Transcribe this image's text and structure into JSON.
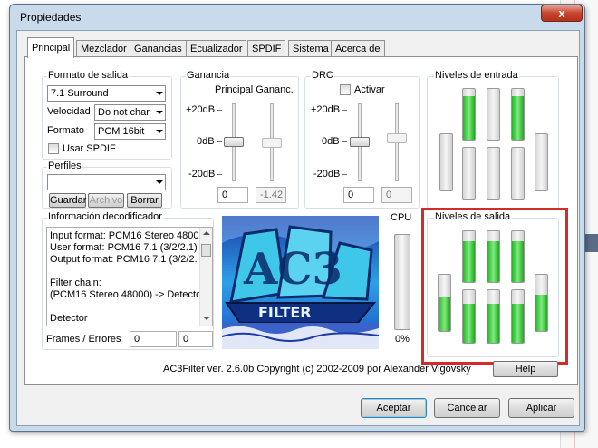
{
  "window": {
    "title": "Propiedades",
    "close_glyph": "x"
  },
  "tabs": [
    {
      "label": "Principal",
      "active": true
    },
    {
      "label": "Mezclador"
    },
    {
      "label": "Ganancias"
    },
    {
      "label": "Ecualizador"
    },
    {
      "label": "SPDIF"
    },
    {
      "label": "Sistema"
    },
    {
      "label": "Acerca de"
    }
  ],
  "output_format": {
    "group_label": "Formato de salida",
    "format_value": "7.1 Surround",
    "speed_label": "Velocidad",
    "speed_value": "Do not char",
    "format_label": "Formato",
    "pcm_value": "PCM 16bit",
    "spdif_label": "Usar SPDIF"
  },
  "profiles": {
    "group_label": "Perfiles",
    "combo_value": "",
    "save_label": "Guardar",
    "file_label": "Archivo",
    "delete_label": "Borrar"
  },
  "gain": {
    "group_label": "Ganancia",
    "header": "Principal Gananc.",
    "tick_top": "+20dB",
    "tick_mid": "0dB",
    "tick_bot": "-20dB",
    "main_value": "0",
    "second_value": "-1.42"
  },
  "drc": {
    "group_label": "DRC",
    "activate_label": "Activar",
    "tick_top": "+20dB",
    "tick_mid": "0dB",
    "tick_bot": "-20dB",
    "main_value": "0",
    "second_value": "0"
  },
  "input_levels": {
    "group_label": "Niveles de entrada",
    "meters": [
      0,
      0.85,
      0,
      0.85,
      0,
      0,
      0
    ]
  },
  "output_levels": {
    "group_label": "Niveles de salida",
    "meters": [
      0.6,
      0.8,
      0.75,
      0.8,
      0.75,
      0.8,
      0.65
    ]
  },
  "decoder_info": {
    "group_label": "Información decodificador",
    "lines": [
      "Input format: PCM16 Stereo 48000",
      "User format: PCM16 7.1 (3/2/2.1)",
      "Output format: PCM16 7.1 (3/2/2.",
      "",
      "Filter chain:",
      "(PCM16 Stereo 48000) -> Detecto",
      "",
      "Detector"
    ],
    "frames_label": "Frames / Errores",
    "frames_value": "0",
    "errors_value": "0"
  },
  "cpu": {
    "label": "CPU",
    "value": "0%",
    "level": 0
  },
  "logo": {
    "text": "AC3",
    "sub_text": "FILTER"
  },
  "footer": {
    "version_text": "AC3Filter ver. 2.6.0b Copyright (c) 2002-2009 por Alexander Vigovsky",
    "help_label": "Help"
  },
  "buttons": {
    "accept": "Aceptar",
    "cancel": "Cancelar",
    "apply": "Aplicar"
  },
  "colors": {
    "meter_green": "#3ccf3c",
    "highlight_red": "#d42a2a",
    "title_bg": "#c9dbeb"
  }
}
